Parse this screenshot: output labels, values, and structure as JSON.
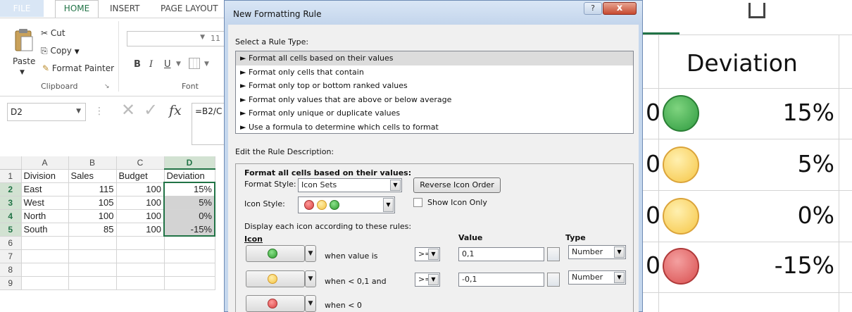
{
  "ribbon": {
    "tabs": [
      "FILE",
      "HOME",
      "INSERT",
      "PAGE LAYOUT"
    ],
    "paste_label": "Paste",
    "cut_label": "Cut",
    "copy_label": "Copy",
    "format_painter_label": "Format Painter",
    "clipboard_group": "Clipboard",
    "font_group": "Font",
    "font_size": "11",
    "bold": "B",
    "italic": "I",
    "underline": "U"
  },
  "formula_bar": {
    "name_box": "D2",
    "fx": "fx",
    "formula": "=B2/C"
  },
  "sheet": {
    "columns": [
      "A",
      "B",
      "C",
      "D"
    ],
    "rows": [
      {
        "n": "1",
        "a": "Division",
        "b": "Sales",
        "c": "Budget",
        "d": "Deviation"
      },
      {
        "n": "2",
        "a": "East",
        "b": "115",
        "c": "100",
        "d": "15%"
      },
      {
        "n": "3",
        "a": "West",
        "b": "105",
        "c": "100",
        "d": "5%"
      },
      {
        "n": "4",
        "a": "North",
        "b": "100",
        "c": "100",
        "d": "0%"
      },
      {
        "n": "5",
        "a": "South",
        "b": "85",
        "c": "100",
        "d": "-15%"
      },
      {
        "n": "6",
        "a": "",
        "b": "",
        "c": "",
        "d": ""
      },
      {
        "n": "7",
        "a": "",
        "b": "",
        "c": "",
        "d": ""
      },
      {
        "n": "8",
        "a": "",
        "b": "",
        "c": "",
        "d": ""
      },
      {
        "n": "9",
        "a": "",
        "b": "",
        "c": "",
        "d": ""
      }
    ]
  },
  "dialog": {
    "title": "New Formatting Rule",
    "help": "?",
    "close": "x",
    "select_rule_type_label": "Select a Rule Type:",
    "rule_types": [
      "► Format all cells based on their values",
      "► Format only cells that contain",
      "► Format only top or bottom ranked values",
      "► Format only values that are above or below average",
      "► Format only unique or duplicate values",
      "► Use a formula to determine which cells to format"
    ],
    "edit_desc_label": "Edit the Rule Description:",
    "format_all_label": "Format all cells based on their values:",
    "format_style_label": "Format Style:",
    "format_style_value": "Icon Sets",
    "reverse_button": "Reverse Icon Order",
    "icon_style_label": "Icon Style:",
    "show_icon_only": "Show Icon Only",
    "display_rules_label": "Display each icon according to these rules:",
    "col_icon": "Icon",
    "col_value": "Value",
    "col_type": "Type",
    "rules": [
      {
        "condition": "when value is",
        "operator": ">=",
        "value": "0,1",
        "type": "Number",
        "color": "green"
      },
      {
        "condition": "when < 0,1 and",
        "operator": ">=",
        "value": "-0,1",
        "type": "Number",
        "color": "yellow"
      },
      {
        "condition": "when < 0",
        "operator": "",
        "value": "",
        "type": "",
        "color": "red"
      }
    ]
  },
  "zoom": {
    "header": "Deviation",
    "rows": [
      {
        "left": "0",
        "value": "15%",
        "color": "green"
      },
      {
        "left": "0",
        "value": "5%",
        "color": "yellow"
      },
      {
        "left": "0",
        "value": "0%",
        "color": "yellow"
      },
      {
        "left": "0",
        "value": "-15%",
        "color": "red"
      }
    ]
  }
}
